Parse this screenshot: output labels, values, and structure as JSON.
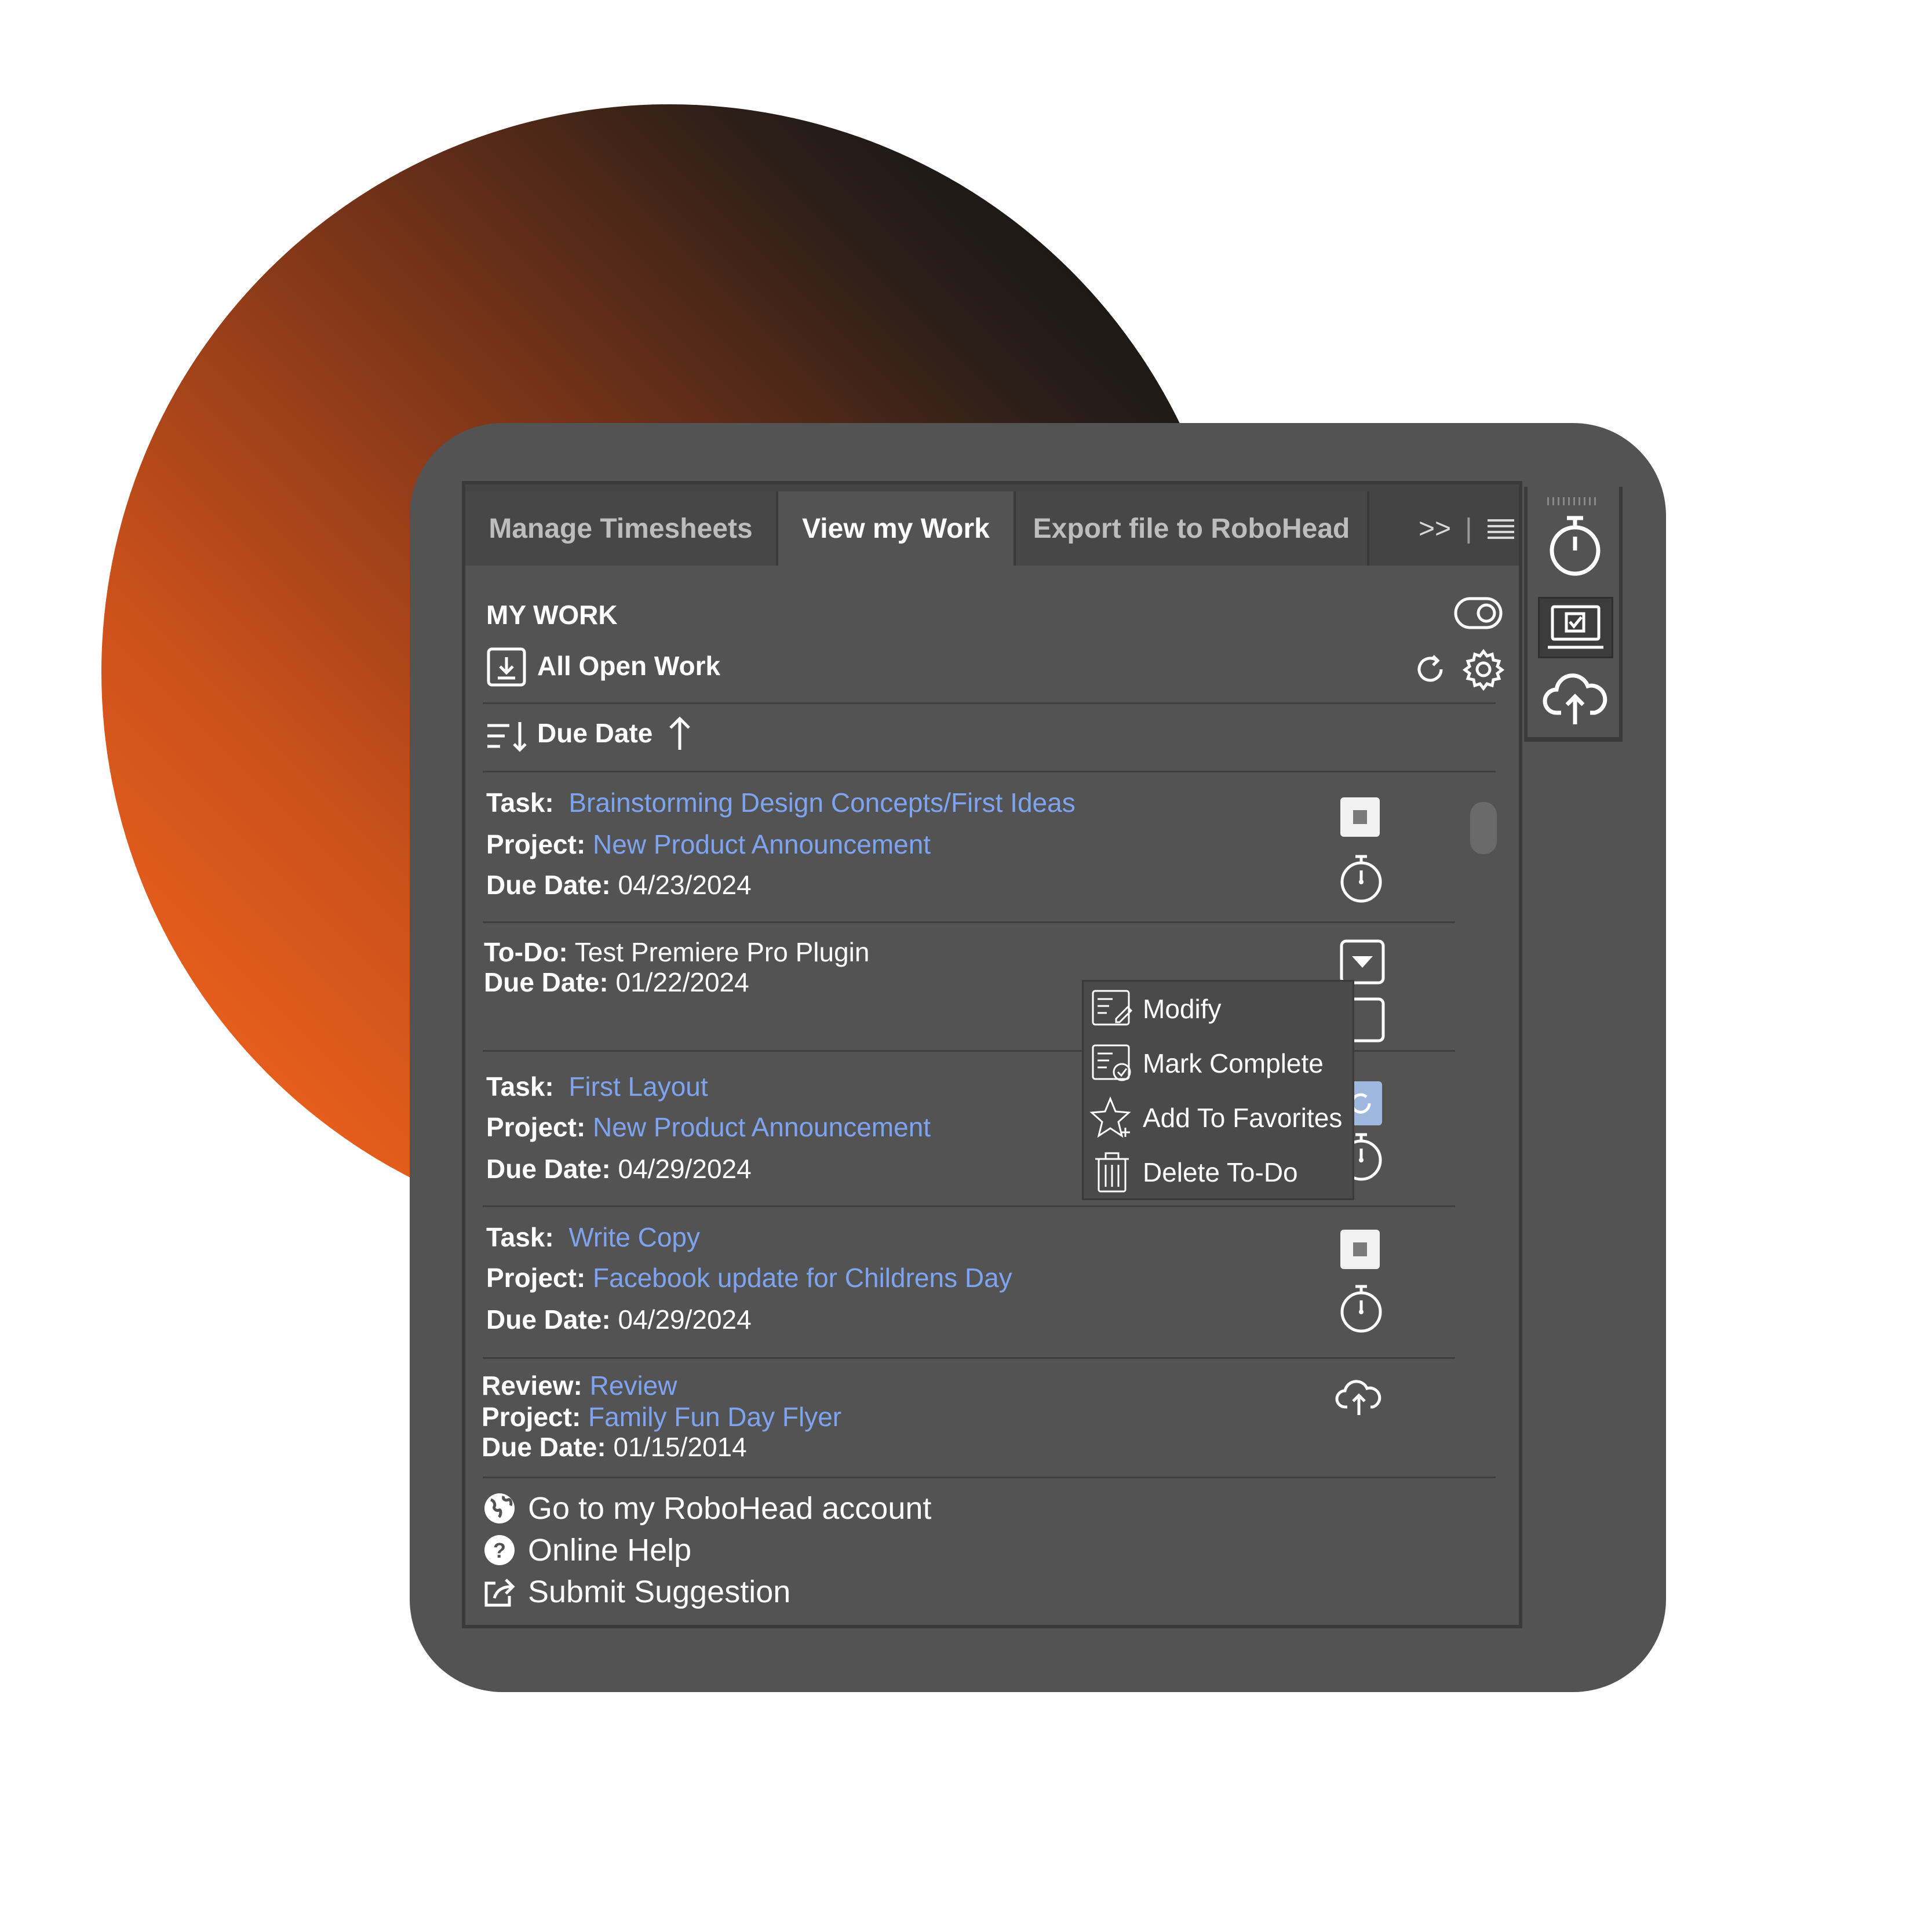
{
  "tabs": [
    {
      "label": "Manage Timesheets",
      "active": false
    },
    {
      "label": "View my Work",
      "active": true
    },
    {
      "label": "Export file to RoboHead",
      "active": false
    }
  ],
  "tab_overflow": ">>",
  "header": {
    "title": "MY WORK",
    "filter_label": "All Open Work",
    "sort_label": "Due Date"
  },
  "items": [
    {
      "kind_label": "Task:",
      "kind_value": "Brainstorming Design Concepts/First Ideas",
      "project_label": "Project:",
      "project_value": "New Product Announcement",
      "due_label": "Due Date:",
      "due_value": "04/23/2024"
    },
    {
      "kind_label": "To-Do:",
      "kind_value": "Test Premiere Pro Plugin",
      "due_label": "Due Date:",
      "due_value": "01/22/2024"
    },
    {
      "kind_label": "Task:",
      "kind_value": "First Layout",
      "project_label": "Project:",
      "project_value": "New Product Announcement",
      "due_label": "Due Date:",
      "due_value": "04/29/2024"
    },
    {
      "kind_label": "Task:",
      "kind_value": "Write Copy",
      "project_label": "Project:",
      "project_value": "Facebook update for Childrens Day",
      "due_label": "Due Date:",
      "due_value": "04/29/2024"
    },
    {
      "kind_label": "Review:",
      "kind_value": "Review",
      "project_label": "Project:",
      "project_value": "Family Fun Day Flyer",
      "due_label": "Due Date:",
      "due_value": "01/15/2014"
    }
  ],
  "context_menu": [
    {
      "label": "Modify",
      "icon": "modify-icon"
    },
    {
      "label": "Mark Complete",
      "icon": "mark-complete-icon"
    },
    {
      "label": "Add To Favorites",
      "icon": "star-icon"
    },
    {
      "label": "Delete To-Do",
      "icon": "trash-icon"
    }
  ],
  "footer": [
    {
      "label": "Go to my RoboHead account",
      "icon": "globe-icon"
    },
    {
      "label": "Online Help",
      "icon": "help-icon"
    },
    {
      "label": "Submit Suggestion",
      "icon": "share-icon"
    }
  ],
  "colors": {
    "panel": "#535353",
    "link": "#7ea4f0",
    "accent": "#ff6a1e"
  }
}
